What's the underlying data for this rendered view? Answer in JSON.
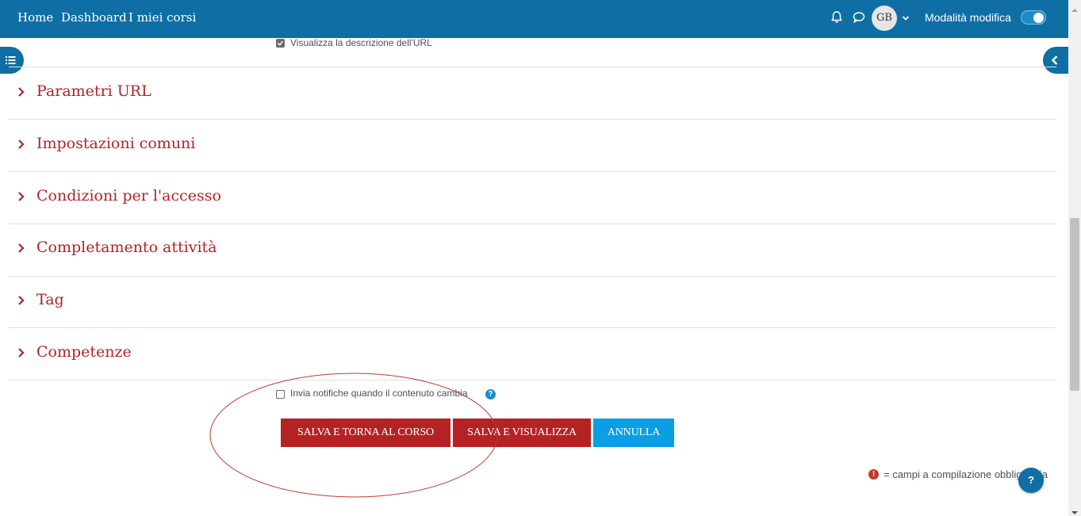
{
  "navbar": {
    "home": "Home",
    "dashboard": "Dashboard",
    "my_courses": "I miei corsi",
    "avatar_initials": "GB",
    "edit_mode_label": "Modalità modifica",
    "edit_mode_on": true
  },
  "form": {
    "show_url_description_label": "Visualizza la descrizione dell'URL",
    "show_url_description_checked": true,
    "sections": [
      {
        "title": "Parametri URL"
      },
      {
        "title": "Impostazioni comuni"
      },
      {
        "title": "Condizioni per l'accesso"
      },
      {
        "title": "Completamento attività"
      },
      {
        "title": "Tag"
      },
      {
        "title": "Competenze"
      }
    ],
    "notify_label": "Invia notifiche quando il contenuto cambia",
    "notify_checked": false,
    "help_glyph": "?",
    "buttons": {
      "save_return": "SALVA E TORNA AL CORSO",
      "save_display": "SALVA E VISUALIZZA",
      "cancel": "ANNULLA"
    },
    "required_icon": "!",
    "required_note": "= campi a compilazione obbligatoria"
  },
  "help_button_glyph": "?",
  "colors": {
    "navbar": "#0f6fa5",
    "section_title": "#b52224",
    "primary_button": "#b52224",
    "cancel_button": "#0a9fe3",
    "annotation_ellipse": "#c0392b"
  },
  "icons": {
    "notifications": "bell-icon",
    "messages": "chat-bubble-icon",
    "user_menu": "chevron-down-icon",
    "course_index_drawer": "list-icon",
    "block_drawer": "chevron-left-icon",
    "section_toggle": "chevron-right-icon",
    "help": "question-circle-icon",
    "required": "exclamation-circle-icon"
  }
}
